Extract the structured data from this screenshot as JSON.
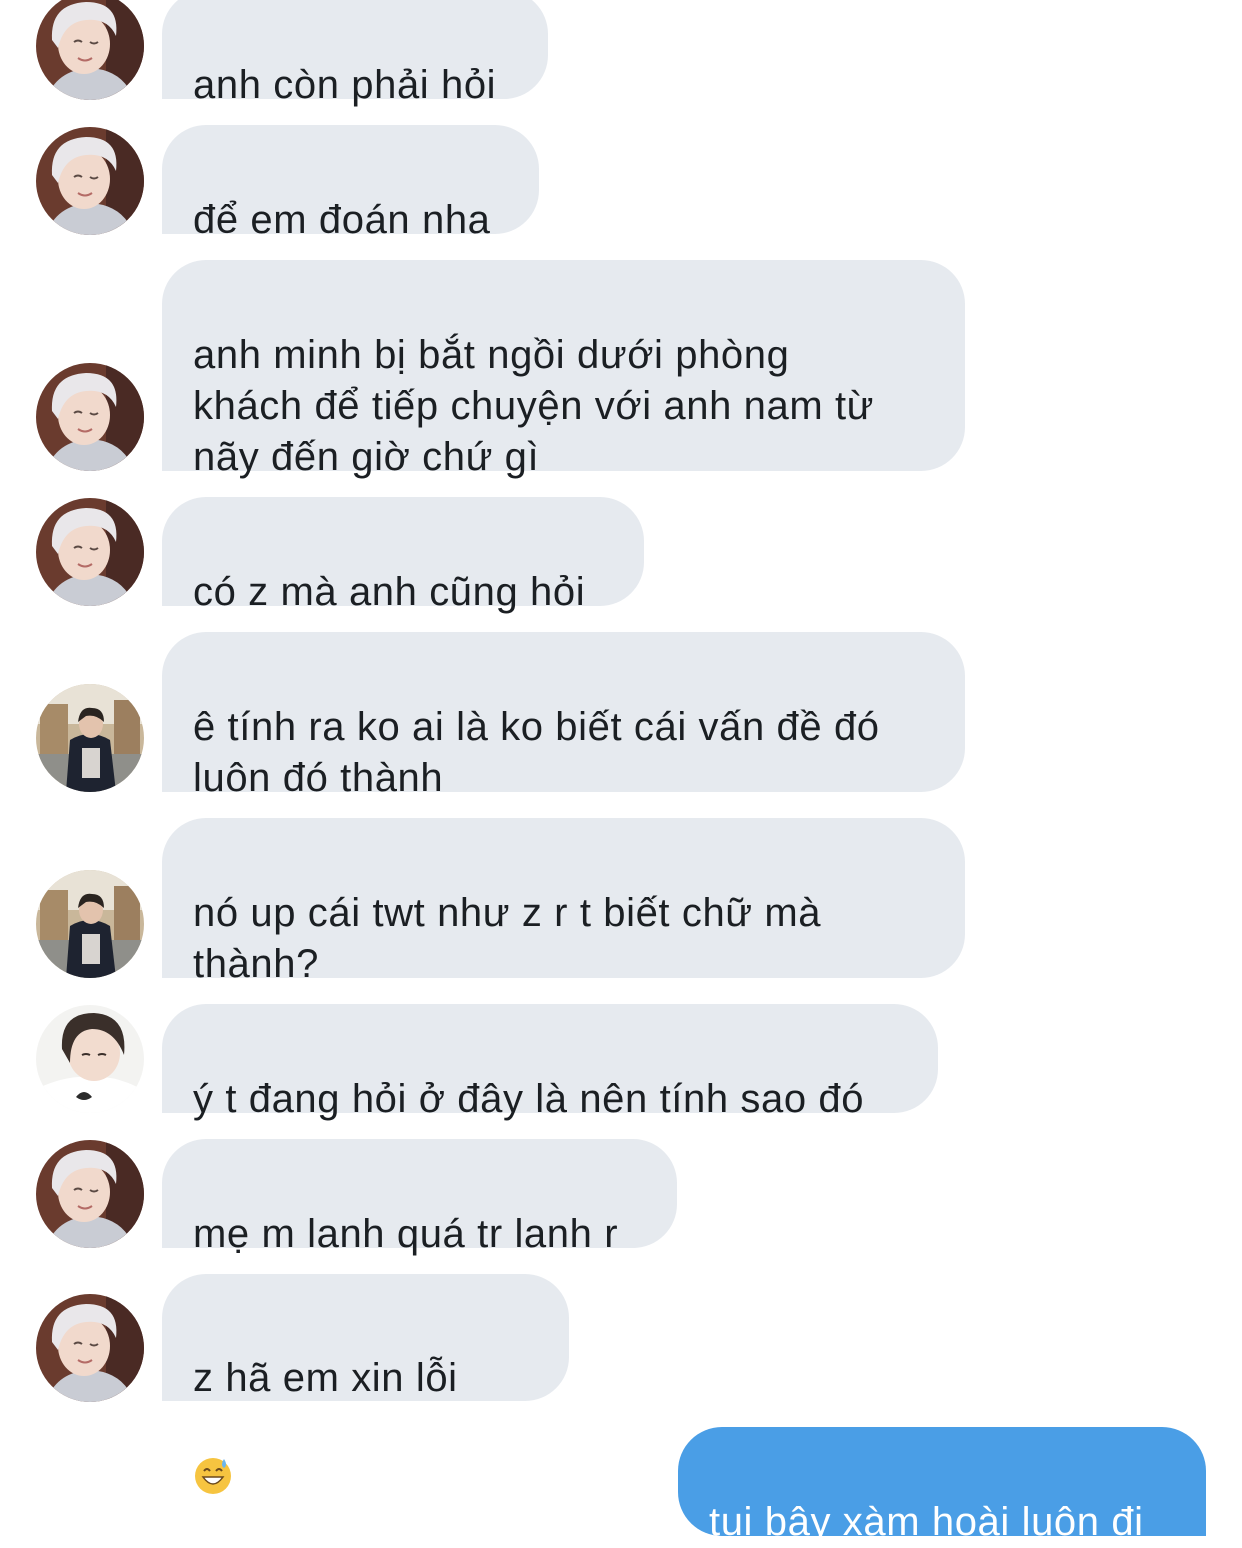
{
  "messages": [
    {
      "text": "anh còn phải hỏi",
      "avatar": "avatar-white-hair"
    },
    {
      "text": "để em đoán nha",
      "avatar": "avatar-white-hair"
    },
    {
      "text": "anh minh bị bắt ngồi dưới phòng\nkhách để tiếp chuyện với anh nam từ\nnãy đến giờ chứ gì",
      "avatar": "avatar-white-hair"
    },
    {
      "text": "có z mà anh cũng hỏi",
      "avatar": "avatar-white-hair"
    },
    {
      "text": "ê tính ra ko ai là ko biết cái vấn đề đó\nluôn đó thành",
      "avatar": "avatar-street-photo"
    },
    {
      "text": "nó up cái twt như z r t biết chữ mà\nthành?",
      "avatar": "avatar-street-photo"
    },
    {
      "text": "ý t đang hỏi ở đây là nên tính sao đó",
      "avatar": "avatar-dark-hair"
    },
    {
      "text": "mẹ m lanh quá tr lanh r",
      "avatar": "avatar-white-hair"
    },
    {
      "text": "z hã em xin lỗi",
      "avatar": "avatar-white-hair",
      "emoji": "grinning-sweat-emoji"
    }
  ],
  "outgoing": {
    "text": "tụi bây xàm hoài luôn đi"
  },
  "colors": {
    "incoming_bubble": "#e6eaef",
    "outgoing_bubble": "#4a9ee6",
    "incoming_text": "#1b1f23",
    "outgoing_text": "#ffffff"
  }
}
